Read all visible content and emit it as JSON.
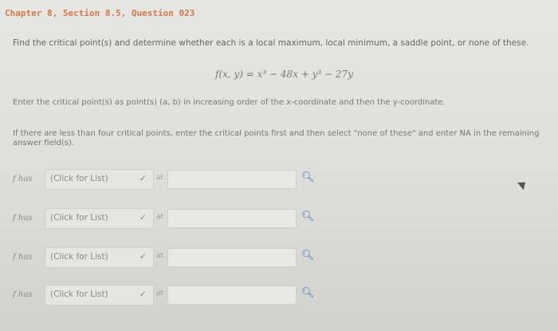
{
  "header": {
    "title": "Chapter 8, Section 8.5, Question 023"
  },
  "question": {
    "instruction": "Find the critical point(s) and determine whether each is a local maximum, local minimum, a saddle point, or none of these.",
    "equation": "f(x, y) = x³ − 48x + y³ − 27y",
    "enter_line": "Enter the critical point(s) as point(s) (a, b) in increasing order of the x-coordinate and then the y-coordinate.",
    "fewer_line": "If there are less than four critical points, enter the critical points first and then select \"none of these\" and enter NA in the remaining answer field(s)."
  },
  "rows": [
    {
      "fhas": "f has",
      "select": "(Click for List)",
      "chevron": "✓",
      "at": "at",
      "value": ""
    },
    {
      "fhas": "f has",
      "select": "(Click for List)",
      "chevron": "✓",
      "at": "at",
      "value": ""
    },
    {
      "fhas": "f has",
      "select": "(Click for List)",
      "chevron": "✓",
      "at": "at",
      "value": ""
    },
    {
      "fhas": "f has",
      "select": "(Click for List)",
      "chevron": "✓",
      "at": "at",
      "value": ""
    }
  ],
  "icons": {
    "search": "search-icon",
    "cursor": "mouse-cursor-icon"
  },
  "colors": {
    "header": "#d07a4a",
    "search": "#3b6fc2"
  }
}
